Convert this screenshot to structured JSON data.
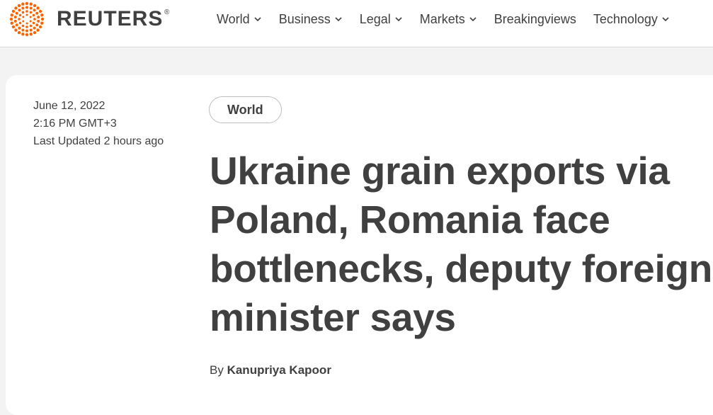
{
  "header": {
    "brand": "REUTERS",
    "registered_mark": "®",
    "nav": [
      {
        "label": "World",
        "has_dropdown": true
      },
      {
        "label": "Business",
        "has_dropdown": true
      },
      {
        "label": "Legal",
        "has_dropdown": true
      },
      {
        "label": "Markets",
        "has_dropdown": true
      },
      {
        "label": "Breakingviews",
        "has_dropdown": false
      },
      {
        "label": "Technology",
        "has_dropdown": true
      }
    ]
  },
  "article": {
    "date": "June 12, 2022",
    "time": "2:16 PM GMT+3",
    "updated": "Last Updated 2 hours ago",
    "section_tag": "World",
    "headline": "Ukraine grain exports via Poland, Romania face bottlenecks, deputy foreign minister says",
    "byline_prefix": "By",
    "author": "Kanupriya Kapoor"
  },
  "colors": {
    "brand_orange": "#fa6400",
    "text": "#404040",
    "page_bg": "#f3f3f3"
  }
}
